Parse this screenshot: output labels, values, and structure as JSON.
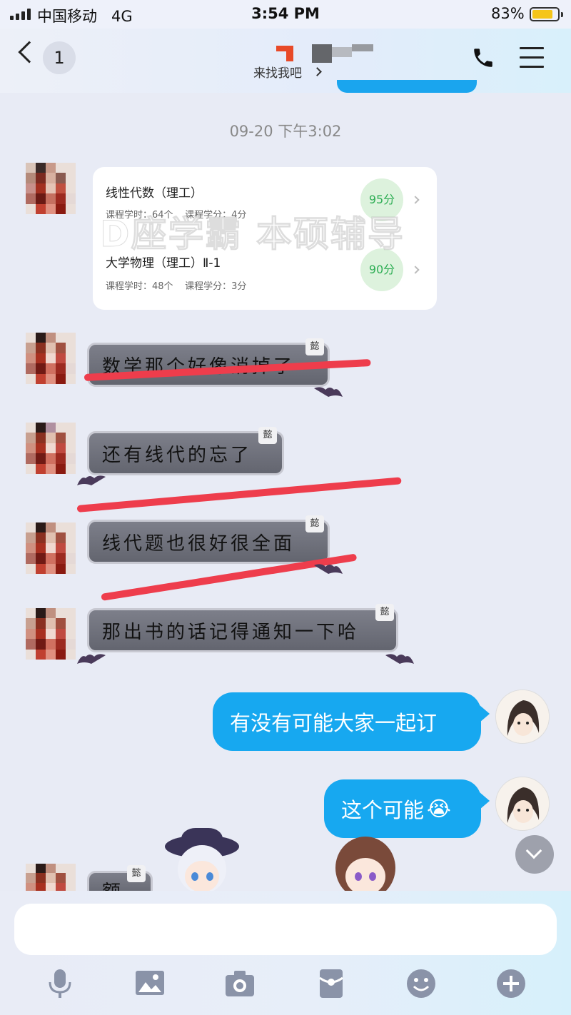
{
  "status_bar": {
    "carrier": "中国移动",
    "network": "4G",
    "time": "3:54 PM",
    "battery": "83%",
    "battery_level": 0.83
  },
  "nav": {
    "back_count": "1",
    "contact_subtitle": "来找我吧",
    "phone_icon": "phone-icon",
    "menu_icon": "menu-icon"
  },
  "timestamp": "09-20 下午3:02",
  "course_card": {
    "courses": [
      {
        "name": "线性代数（理工）",
        "hours_label": "课程学时：",
        "hours": "64个",
        "credits_label": "课程学分：",
        "credits": "4分",
        "score": "95分"
      },
      {
        "name": "大学物理（理工）Ⅱ-1",
        "hours_label": "课程学时：",
        "hours": "48个",
        "credits_label": "课程学分：",
        "credits": "3分",
        "score": "90分"
      }
    ]
  },
  "watermark": "D座学霸 本硕辅导",
  "messages": [
    {
      "sender": "other",
      "text": "数学那个好像消掉了",
      "tag": "懿"
    },
    {
      "sender": "other",
      "text": "还有线代的忘了",
      "tag": "懿"
    },
    {
      "sender": "other",
      "text": "线代题也很好很全面",
      "tag": "懿"
    },
    {
      "sender": "other",
      "text": "那出书的话记得通知一下哈",
      "tag": "懿"
    },
    {
      "sender": "me",
      "text": "有没有可能大家一起订"
    },
    {
      "sender": "me",
      "text": "这个可能",
      "emoji": "😭"
    },
    {
      "sender": "other",
      "text": "额",
      "tag": "懿"
    }
  ],
  "input": {
    "placeholder": ""
  },
  "toolbar": [
    "mic-icon",
    "image-icon",
    "camera-icon",
    "red-packet-icon",
    "emoji-icon",
    "plus-icon"
  ],
  "colors": {
    "accent": "#17a8f0",
    "strike": "#ee3d4c",
    "score_green": "#2fae55"
  }
}
